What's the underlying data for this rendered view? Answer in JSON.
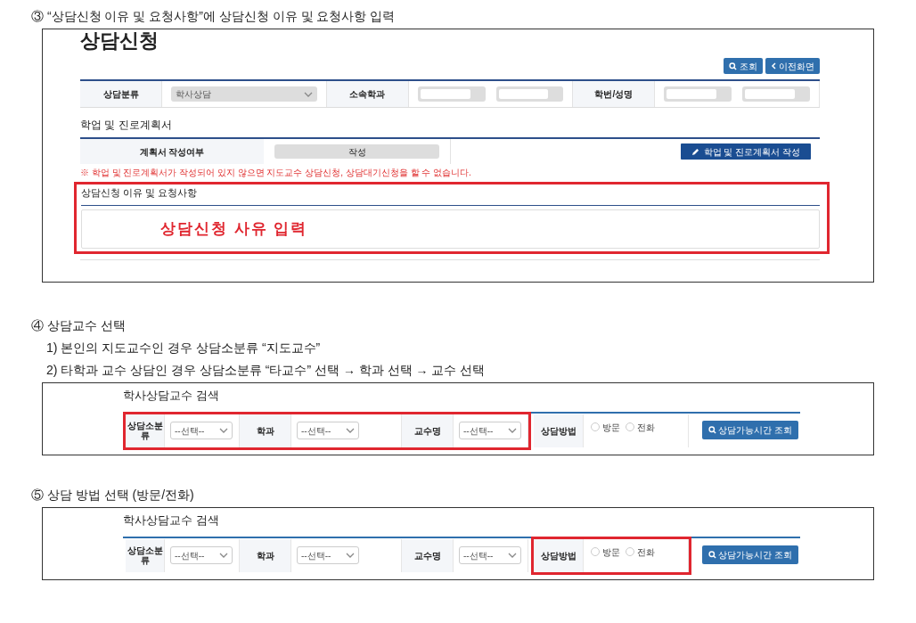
{
  "steps": [
    {
      "heading": "③ “상담신청 이유 및 요청사항”에 상담신청 이유 및 요청사항 입력",
      "panel": {
        "kind": "application",
        "title": "상담신청",
        "buttons": [
          {
            "kind": "search",
            "label": "조회"
          },
          {
            "kind": "back",
            "label": "이전화면"
          }
        ],
        "fields": [
          {
            "label": "상담분류",
            "value": "학사상담",
            "disabled": true
          },
          {
            "label": "소속학과",
            "disabled": true
          },
          {
            "label": "학번/성명",
            "disabled": true
          }
        ],
        "plan": {
          "title": "학업 및 진로계획서",
          "label": "계획서 작성여부",
          "value": "작성",
          "button": "학업 및 진로계획서 작성",
          "warning": "※ 학업 및 진로계획서가 작성되어 있지 않으면 지도교수 상담신청, 상담대기신청을 할 수 없습니다."
        },
        "reason": {
          "title": "상담신청 이유 및 요청사항",
          "value": "상담신청 사유 입력",
          "highlighted": true
        }
      }
    },
    {
      "heading": "④ 상담교수 선택",
      "lines": [
        "1) 본인의 지도교수인 경우 상담소분류 “지도교수”",
        "2) 타학과 교수 상담인 경우 상담소분류 “타교수” 선택 → 학과 선택 → 교수 선택"
      ],
      "panel": {
        "kind": "search",
        "title": "학사상담교수 검색",
        "filters": {
          "highlighted": true,
          "items": [
            {
              "label": "상담소분류",
              "value": "--선택--"
            },
            {
              "label": "학과",
              "value": "--선택--"
            },
            {
              "label": "교수명",
              "value": "--선택--"
            }
          ]
        },
        "method": {
          "label": "상담방법",
          "highlighted": false,
          "options": [
            {
              "label": "방문",
              "selected": false
            },
            {
              "label": "전화",
              "selected": false
            }
          ]
        },
        "button": "상담가능시간 조회"
      }
    },
    {
      "heading": "⑤ 상담 방법 선택 (방문/전화)",
      "panel": {
        "kind": "search",
        "title": "학사상담교수 검색",
        "filters": {
          "highlighted": false,
          "items": [
            {
              "label": "상담소분류",
              "value": "--선택--"
            },
            {
              "label": "학과",
              "value": "--선택--"
            },
            {
              "label": "교수명",
              "value": "--선택--"
            }
          ]
        },
        "method": {
          "label": "상담방법",
          "highlighted": true,
          "options": [
            {
              "label": "방문",
              "selected": false
            },
            {
              "label": "전화",
              "selected": false
            }
          ]
        },
        "button": "상담가능시간 조회"
      }
    }
  ]
}
